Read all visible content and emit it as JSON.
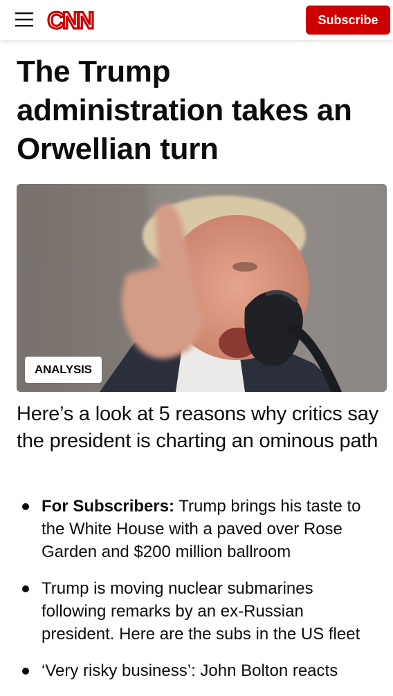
{
  "header": {
    "logo_text": "CNN",
    "subscribe_label": "Subscribe",
    "brand_color": "#cc0000"
  },
  "article": {
    "headline": "The Trump administration takes an Orwellian turn",
    "badge": "ANALYSIS",
    "subhead": "Here’s a look at 5 reasons why critics say the president is charting an ominous path"
  },
  "bullets": [
    {
      "prefix": "For Subscribers:",
      "text": " Trump brings his taste to the White House with a paved over Rose Garden and $200 million ballroom"
    },
    {
      "prefix": "",
      "text": "Trump is moving nuclear submarines following remarks by an ex-Russian president. Here are the subs in the US fleet"
    },
    {
      "prefix": "",
      "text": "‘Very risky business’: John Bolton reacts"
    }
  ],
  "icons": {
    "menu": "menu-icon",
    "logo": "cnn-logo"
  }
}
